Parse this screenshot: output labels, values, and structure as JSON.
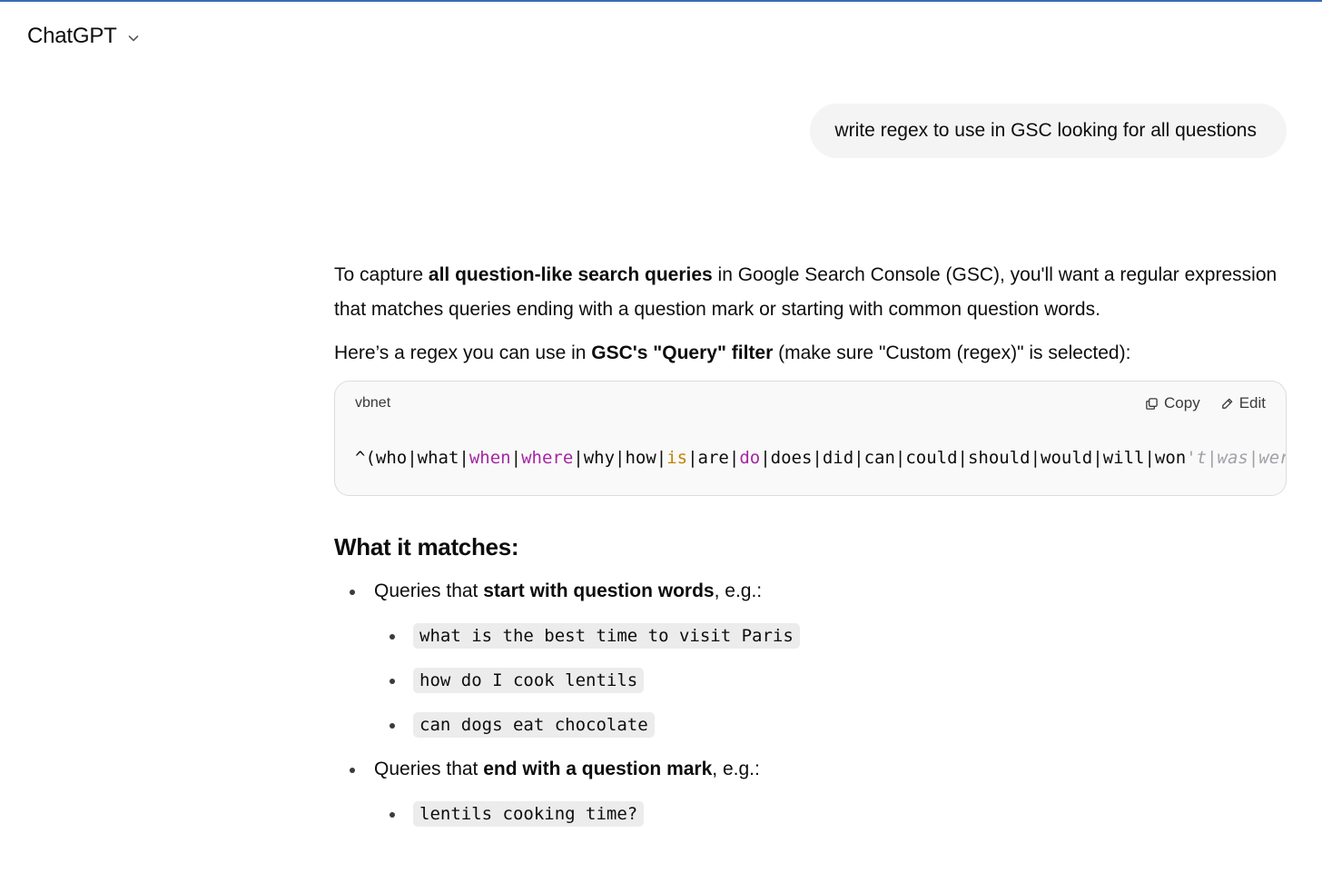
{
  "header": {
    "title": "ChatGPT",
    "chevron_icon": "chevron-down-icon"
  },
  "user_message": "write regex to use in GSC looking for all questions",
  "answer": {
    "intro": [
      {
        "text": "To capture ",
        "bold": false
      },
      {
        "text": "all question-like search queries",
        "bold": true
      },
      {
        "text": " in Google Search Console (GSC), you'll want a regular expression that matches queries ending with a question mark or starting with common question words.",
        "bold": false
      }
    ],
    "line2": [
      {
        "text": "Here’s a regex you can use in ",
        "bold": false
      },
      {
        "text": "GSC's \"Query\" filter",
        "bold": true
      },
      {
        "text": " (make sure \"Custom (regex)\" is selected):",
        "bold": false
      }
    ],
    "code": {
      "language": "vbnet",
      "copy_label": "Copy",
      "edit_label": "Edit",
      "tokens": [
        {
          "t": "^(who|what|",
          "c": "#0d0d0d"
        },
        {
          "t": "when",
          "c": "#a626a4"
        },
        {
          "t": "|",
          "c": "#0d0d0d"
        },
        {
          "t": "where",
          "c": "#a626a4"
        },
        {
          "t": "|why|how|",
          "c": "#0d0d0d"
        },
        {
          "t": "is",
          "c": "#c18401"
        },
        {
          "t": "|are|",
          "c": "#0d0d0d"
        },
        {
          "t": "do",
          "c": "#a626a4"
        },
        {
          "t": "|does|did|can|could|should|would|will|won",
          "c": "#0d0d0d"
        },
        {
          "t": "'t|was|were|have|has|had)\\b|\\?$",
          "c": "#a0a1a7",
          "italic": true
        }
      ]
    },
    "section_title": "What it matches:",
    "bullets": [
      {
        "parts": [
          {
            "text": "Queries that ",
            "bold": false
          },
          {
            "text": "start with question words",
            "bold": true
          },
          {
            "text": ", e.g.:",
            "bold": false
          }
        ],
        "examples": [
          "what is the best time to visit Paris",
          "how do I cook lentils",
          "can dogs eat chocolate"
        ]
      },
      {
        "parts": [
          {
            "text": "Queries that ",
            "bold": false
          },
          {
            "text": "end with a question mark",
            "bold": true
          },
          {
            "text": ", e.g.:",
            "bold": false
          }
        ],
        "examples": [
          "lentils cooking time?"
        ]
      }
    ]
  }
}
